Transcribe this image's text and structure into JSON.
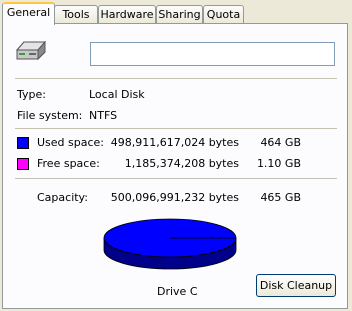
{
  "tabs": [
    {
      "label": "General",
      "active": true
    },
    {
      "label": "Tools",
      "active": false
    },
    {
      "label": "Hardware",
      "active": false
    },
    {
      "label": "Sharing",
      "active": false
    },
    {
      "label": "Quota",
      "active": false
    }
  ],
  "drive": {
    "name_value": "",
    "icon": "hard-drive-icon"
  },
  "info": {
    "type_label": "Type:",
    "type_value": "Local Disk",
    "fs_label": "File system:",
    "fs_value": "NTFS"
  },
  "space": {
    "used_label": "Used space:",
    "used_bytes": "498,911,617,024 bytes",
    "used_gb": "464 GB",
    "used_color": "#0000ff",
    "free_label": "Free space:",
    "free_bytes": "1,185,374,208 bytes",
    "free_gb": "1.10 GB",
    "free_color": "#ff00ff",
    "capacity_label": "Capacity:",
    "capacity_bytes": "500,096,991,232 bytes",
    "capacity_gb": "465 GB"
  },
  "pie": {
    "used_fraction": 0.9976,
    "free_fraction": 0.0024
  },
  "drive_label": "Drive C",
  "cleanup_button": "Disk Cleanup"
}
